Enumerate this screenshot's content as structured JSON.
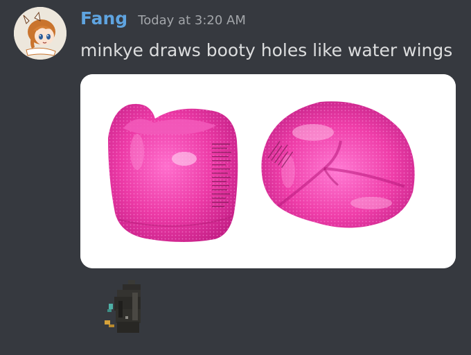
{
  "message": {
    "author": "Fang",
    "timestamp": "Today at 3:20 AM",
    "text": "minkye draws booty holes like water wings",
    "username_color": "#5fa4e0",
    "avatar_icon": "anime-girl-avatar",
    "attachment_icon": "pink-water-wings-image",
    "reaction_icon": "pixel-sticker-emoji"
  },
  "theme": {
    "background": "#36393f",
    "text": "#dcddde",
    "timestamp": "#a3a6aa"
  }
}
